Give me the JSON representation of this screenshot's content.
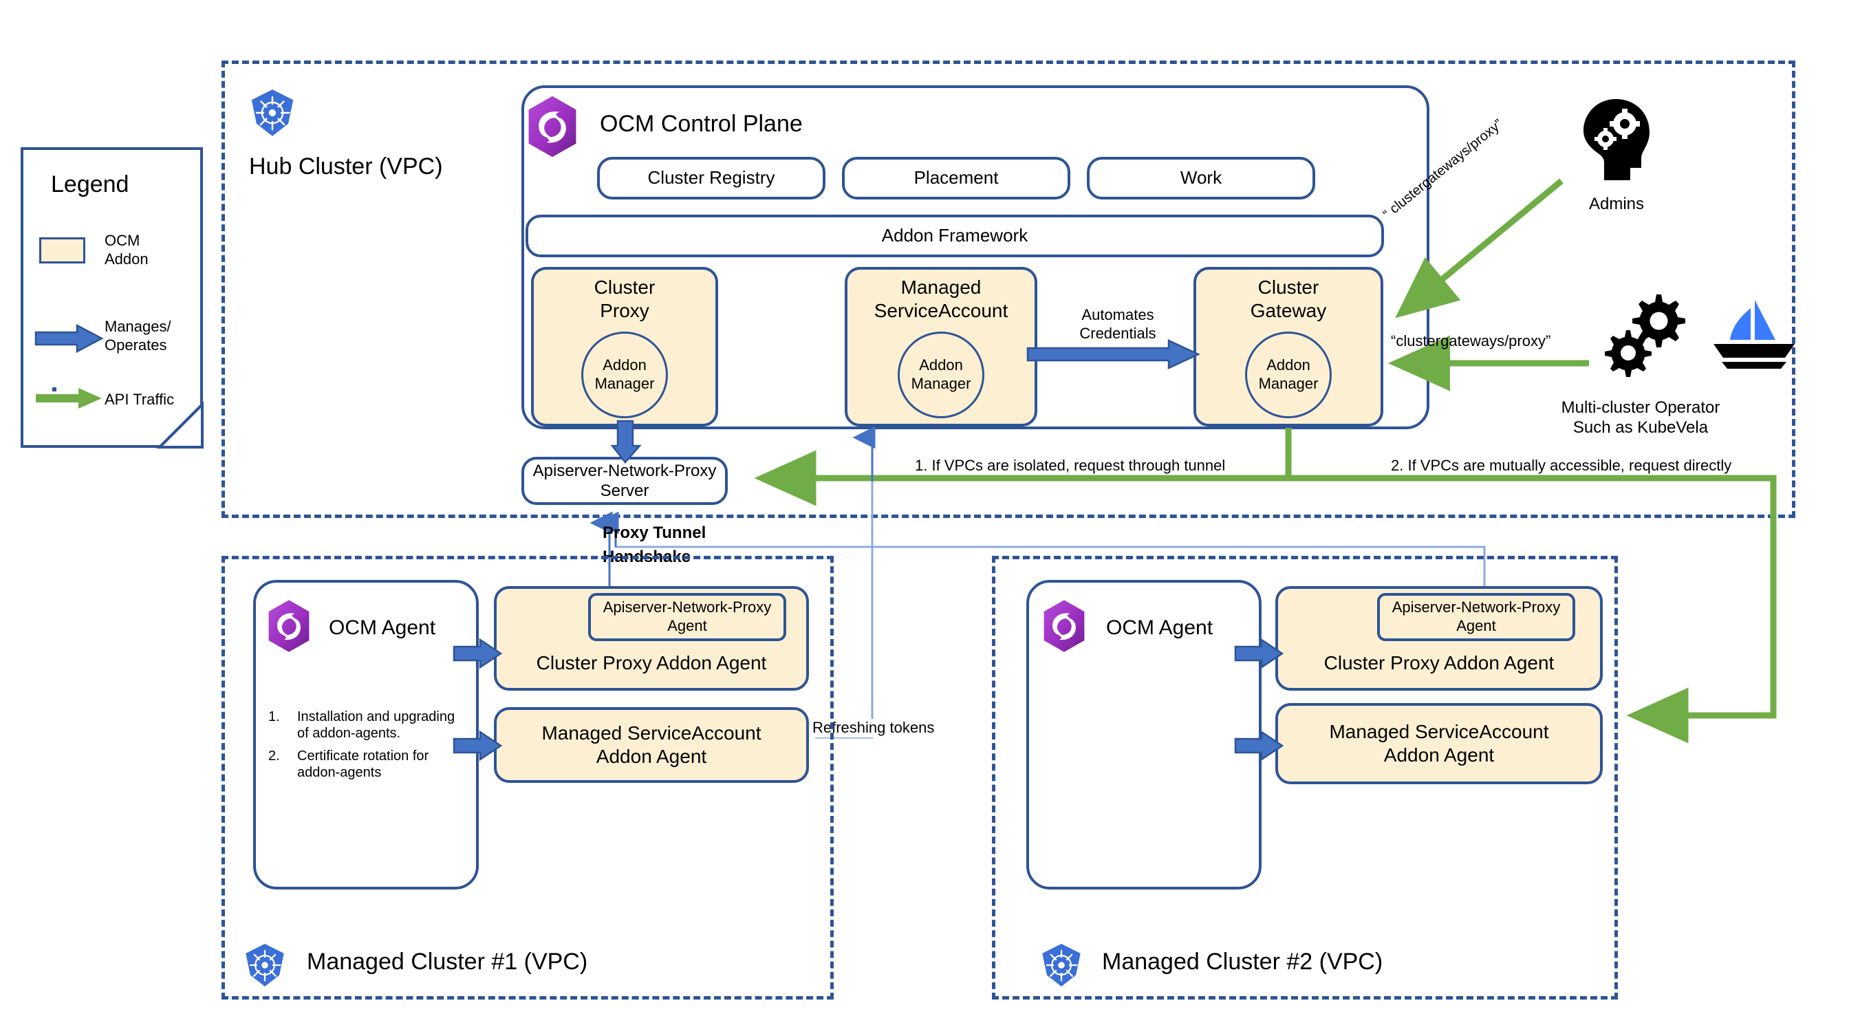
{
  "legend": {
    "title": "Legend",
    "items": [
      {
        "type": "swatch",
        "label": "OCM\nAddon",
        "color": "#FDEFD2"
      },
      {
        "type": "arrow-blue",
        "label": "Manages/\nOperates",
        "color": "#4472C4"
      },
      {
        "type": "arrow-green",
        "label": "API Traffic",
        "color": "#70AD47"
      }
    ]
  },
  "hub": {
    "label": "Hub Cluster (VPC)",
    "icon": "kubernetes-icon",
    "control_plane": {
      "title": "OCM Control Plane",
      "icon": "ocm-logo-icon",
      "modules": [
        "Cluster Registry",
        "Placement",
        "Work"
      ],
      "framework": "Addon Framework",
      "addons": [
        {
          "title": "Cluster\nProxy",
          "manager": "Addon\nManager"
        },
        {
          "title": "Managed\nServiceAccount",
          "manager": "Addon\nManager"
        },
        {
          "title": "Cluster\nGateway",
          "manager": "Addon\nManager"
        }
      ],
      "automates_label": "Automates\nCredentials"
    },
    "proxy_server": "Apiserver-Network-Proxy\nServer"
  },
  "actors": {
    "admins": {
      "label": "Admins",
      "icon": "head-with-gears-icon"
    },
    "operator": {
      "label": "Multi-cluster Operator\nSuch as KubeVela",
      "icon": "gears-icon",
      "logo": "kubevela-sailboat-icon"
    }
  },
  "api_labels": {
    "diagonal": "“ clustergateways/proxy”",
    "horizontal": "“clustergateways/proxy”",
    "tunnel_note_1": "1. If VPCs are  isolated, request through tunnel",
    "tunnel_note_2": "2. If VPCs are  mutually accessible, request directly"
  },
  "connectors": {
    "proxy_tunnel_handshake": "Proxy Tunnel\nHandshake",
    "refreshing_tokens": "Refreshing tokens"
  },
  "managed_clusters": [
    {
      "label": "Managed Cluster #1 (VPC)",
      "icon": "kubernetes-icon",
      "agent": {
        "title": "OCM Agent",
        "icon": "ocm-logo-icon",
        "duties": [
          "Installation and upgrading of addon-agents.",
          "Certificate rotation for addon-agents"
        ]
      },
      "boxes": [
        {
          "inner": "Apiserver-Network-Proxy\nAgent",
          "title": "Cluster Proxy Addon Agent"
        },
        {
          "title": "Managed ServiceAccount\nAddon Agent"
        }
      ]
    },
    {
      "label": "Managed Cluster #2 (VPC)",
      "icon": "kubernetes-icon",
      "agent": {
        "title": "OCM Agent",
        "icon": "ocm-logo-icon",
        "duties": []
      },
      "boxes": [
        {
          "inner": "Apiserver-Network-Proxy\nAgent",
          "title": "Cluster Proxy Addon Agent"
        },
        {
          "title": "Managed ServiceAccount\nAddon Agent"
        }
      ]
    }
  ],
  "colors": {
    "navy": "#2E5496",
    "blue_arrow": "#4472C4",
    "green_arrow": "#70AD47",
    "addon_fill": "#FDEFD2",
    "k8s_blue": "#3A6FD8",
    "ocm_purple": "#9B3FC4",
    "thin_line": "#8FAADC"
  }
}
